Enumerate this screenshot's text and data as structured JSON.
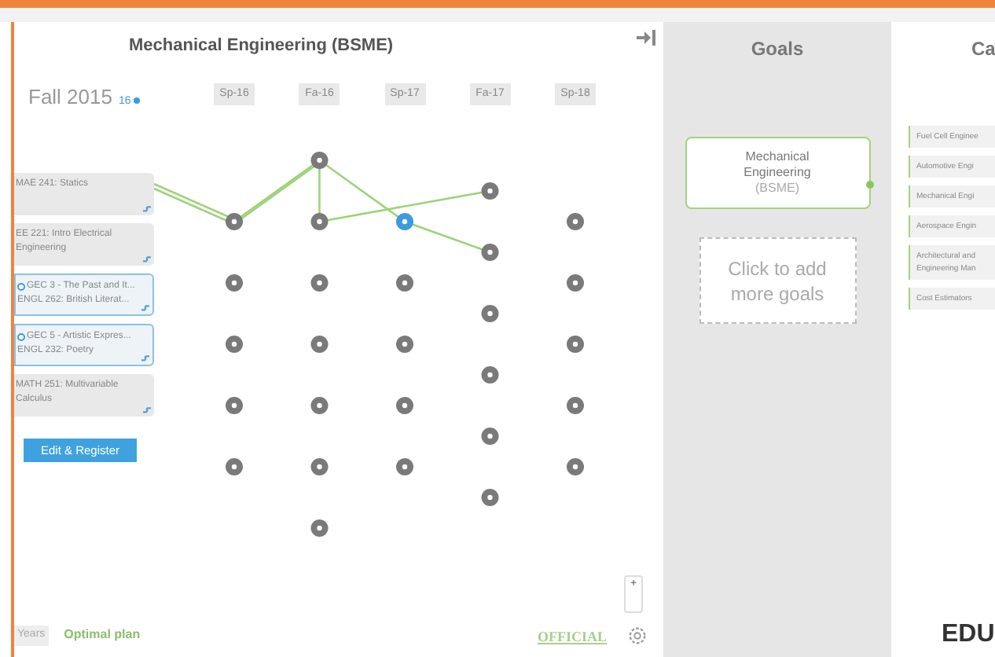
{
  "plan": {
    "title": "Mechanical Engineering (BSME)",
    "current_term": {
      "label": "Fall 2015",
      "credits": "16"
    },
    "terms": [
      {
        "label": "Sp-16",
        "nodes": [
          {
            "selected": false
          },
          {
            "selected": false
          },
          {
            "selected": false
          },
          {
            "selected": false
          },
          {
            "selected": false
          }
        ]
      },
      {
        "label": "Fa-16",
        "nodes": [
          {
            "selected": false
          },
          {
            "selected": false
          },
          {
            "selected": false
          },
          {
            "selected": false
          },
          {
            "selected": false
          },
          {
            "selected": false
          },
          {
            "selected": false
          }
        ]
      },
      {
        "label": "Sp-17",
        "nodes": [
          {
            "selected": true
          },
          {
            "selected": false
          },
          {
            "selected": false
          },
          {
            "selected": false
          },
          {
            "selected": false
          }
        ]
      },
      {
        "label": "Fa-17",
        "nodes": [
          {
            "selected": false
          },
          {
            "selected": false
          },
          {
            "selected": false
          },
          {
            "selected": false
          },
          {
            "selected": false
          },
          {
            "selected": false
          }
        ]
      },
      {
        "label": "Sp-18",
        "nodes": [
          {
            "selected": false
          },
          {
            "selected": false
          },
          {
            "selected": false
          },
          {
            "selected": false
          },
          {
            "selected": false
          }
        ]
      }
    ],
    "courses": [
      {
        "lines": [
          "MAE 241: Statics"
        ],
        "flagged": false
      },
      {
        "lines": [
          "EE 221: Intro Electrical Engineering"
        ],
        "flagged": false
      },
      {
        "lines": [
          "GEC 3 - The Past and It...",
          "ENGL 262: British Literat..."
        ],
        "flagged": true
      },
      {
        "lines": [
          "GEC 5 - Artistic Expres...",
          "ENGL 232: Poetry"
        ],
        "flagged": true
      },
      {
        "lines": [
          "MATH 251: Multivariable Calculus"
        ],
        "flagged": false
      }
    ],
    "edit_button": "Edit & Register",
    "view_tabs": [
      {
        "label": "Years",
        "selected": false
      },
      {
        "label": "Optimal plan",
        "selected": true
      }
    ],
    "official_stamp": "OFFICIAL",
    "zoom_in": "+"
  },
  "goals": {
    "title": "Goals",
    "items": [
      {
        "name": "Mechanical Engineering",
        "degree": "(BSME)"
      }
    ],
    "add_prompt": "Click to add more goals"
  },
  "careers": {
    "title": "Ca",
    "items": [
      "Fuel Cell Enginee",
      "Automotive Engi",
      "Mechanical Engi",
      "Aerospace Engin",
      "Architectural and Engineering Man",
      "Cost Estimators"
    ]
  },
  "brand": "EDU"
}
